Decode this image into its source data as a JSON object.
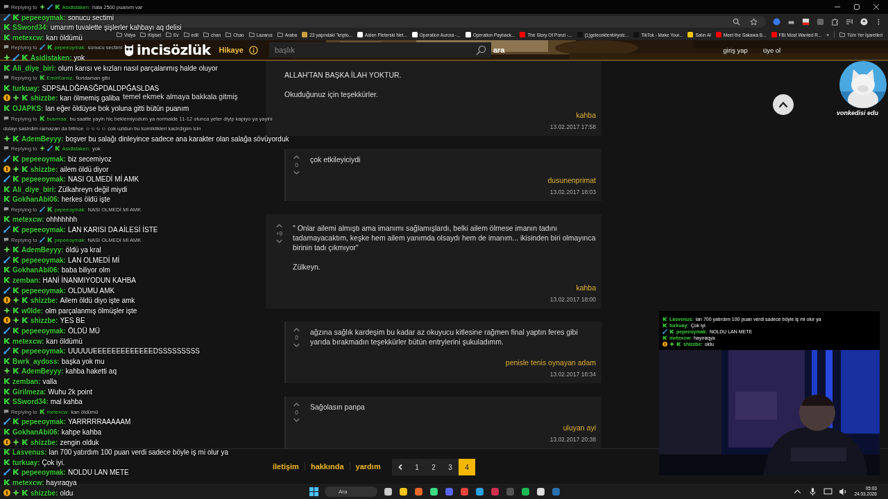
{
  "browser": {
    "bookmarks": [
      {
        "kind": "folder",
        "label": "Vidya"
      },
      {
        "kind": "folder",
        "label": "Kişisel"
      },
      {
        "kind": "folder",
        "label": "Ev"
      },
      {
        "kind": "folder",
        "label": "edit"
      },
      {
        "kind": "folder",
        "label": "chan"
      },
      {
        "kind": "folder",
        "label": "Chao"
      },
      {
        "kind": "folder",
        "label": "Lazarus"
      },
      {
        "kind": "folder",
        "label": "Araba"
      },
      {
        "kind": "link",
        "label": "23 yaşındaki \"kripto...",
        "color": "#c8a040"
      },
      {
        "kind": "link",
        "label": "Aiden Pleterski Net...",
        "color": "#ffffff"
      },
      {
        "kind": "link",
        "label": "Operation Aurora -...",
        "color": "#ffffff"
      },
      {
        "kind": "link",
        "label": "Operation Payback...",
        "color": "#ffffff"
      },
      {
        "kind": "link",
        "label": "The Story Of Ponzi -...",
        "color": "#ff0000"
      },
      {
        "kind": "link",
        "label": "(1)gelecektenbiryolc...",
        "color": "#111111"
      },
      {
        "kind": "link",
        "label": "TikTok - Make Your...",
        "color": "#111111"
      },
      {
        "kind": "link",
        "label": "Satın Al",
        "color": "#f5c518"
      },
      {
        "kind": "link",
        "label": "Meet the Sakawa B...",
        "color": "#ff0000"
      },
      {
        "kind": "link",
        "label": "FBI Most Wanted R...",
        "color": "#ff0000"
      }
    ],
    "more": "»",
    "all_bookmarks": "Tüm Yer İşaretleri"
  },
  "site_header": {
    "logo": "incisözlük",
    "story": "Hikaye",
    "search": {
      "placeholder": "başlık"
    },
    "search_button": "ara",
    "login": "giriş yap",
    "register": "üye ol"
  },
  "sidebar": {
    "topics": [
      "temel ekmek almaya bakkala gitmiş"
    ]
  },
  "entries": [
    {
      "kind": "entry",
      "paragraphs": [
        "ALLAH'TAN BAŞKA İLAH YOKTUR.",
        "Okuduğunuz için teşekkürler."
      ],
      "author": "kahba",
      "date": "13.02.2017 17:58"
    },
    {
      "kind": "reply",
      "votes": "0",
      "paragraphs": [
        "çok etkileyiciydi"
      ],
      "author": "dusunenprimat",
      "date": "13.02.2017 18:03"
    },
    {
      "kind": "entry",
      "votes": "+9",
      "paragraphs": [
        "\" Onlar ailemi almıştı ama imanımı sağlamışlardı, belki ailem ölmese imanın tadını tadamayacaktım, keşke hem ailem yanımda olsaydı hem de imanım... ikisinden biri olmayınca birinin tadı çıkmıyor\"",
        "Zülkeyn."
      ],
      "author": "kahba",
      "date": "13.02.2017 18:00"
    },
    {
      "kind": "reply",
      "votes": "0",
      "paragraphs": [
        "ağzına sağlık kardeşim bu kadar az okuyucu kitlesine rağmen final yaptın feres gibi yarıda bırakmadın teşekkürler bütün entrylerini şukuladımm."
      ],
      "author": "penisle tenis oynayan adam",
      "date": "13.02.2017 18:34"
    },
    {
      "kind": "reply",
      "votes": "0",
      "paragraphs": [
        "Sağolasın panpa"
      ],
      "author": "uluyan ayi",
      "date": "13.02.2017 20:38"
    }
  ],
  "pagination": {
    "pages": [
      {
        "label": "1",
        "selected": false
      },
      {
        "label": "2",
        "selected": false
      },
      {
        "label": "3",
        "selected": false
      },
      {
        "label": "4",
        "selected": true
      }
    ]
  },
  "footer": {
    "links": [
      "iletişim",
      "hakkında",
      "yardım"
    ]
  },
  "profile_overlay": {
    "label": "vonkedisi edu"
  },
  "chat": {
    "lines": [
      {
        "kind": "reply",
        "label": "Replying to",
        "badges": [
          {
            "kind": "diamond"
          },
          {
            "kind": "sword"
          }
        ],
        "user": "Asidistaken:",
        "text": "hala 2500 puanım var"
      },
      {
        "kind": "message",
        "badges": [
          {
            "kind": "sword"
          }
        ],
        "user": "pepeeoymak:",
        "text": "sonucu sectimi"
      },
      {
        "kind": "message",
        "user": "SSword34:",
        "text": "umarım tuvalette şişlerler kahbayı aq delisi"
      },
      {
        "kind": "message",
        "user": "metexcw:",
        "text": "karı öldümü"
      },
      {
        "kind": "reply",
        "label": "Replying to",
        "badges": [
          {
            "kind": "sword"
          }
        ],
        "user": "pepeeoymak:",
        "text": "sonucu sectimi"
      },
      {
        "kind": "message",
        "badges": [
          {
            "kind": "diamond"
          },
          {
            "kind": "sword"
          }
        ],
        "user": "Asidistaken:",
        "text": "yok"
      },
      {
        "kind": "message",
        "user": "Ali_diye_biri:",
        "text": "olum karısı ve kızları nasıl parçalanmış halde oluyor"
      },
      {
        "kind": "reply",
        "label": "Replying to",
        "user": "EmirKorniz:",
        "text": "floridaman gibi"
      },
      {
        "kind": "message",
        "user": "turkuay:",
        "text": "SDPSALDĞPASĞPDALDPĞASLDAS"
      },
      {
        "kind": "message",
        "badges": [
          {
            "kind": "one"
          },
          {
            "kind": "diamond"
          }
        ],
        "user": "shizzbe:",
        "text": "karı ölmemiş galiba"
      },
      {
        "kind": "message",
        "user": "OJAPKS:",
        "text": "lan eğer öldüyse bok yoluna gitti bütün puanım"
      },
      {
        "kind": "reply",
        "label": "Replying to",
        "user": "busrrraa:",
        "text": "bu saatte yayin hic beklemiyodum ya normalde 11-12 olunca yeter diyip kapiyo ya yayini",
        "continuation": "dolayı sasirdim ramazan da bitince ☺☺☺☺ cok uzldun bu komiklikleri kacirdigim icin"
      },
      {
        "kind": "message",
        "badges": [
          {
            "kind": "diamond"
          }
        ],
        "user": "AdemBeyyy:",
        "text": "boşver bu salağı dinleyince sadece ana karakter olan salağa sövüyorduk"
      },
      {
        "kind": "reply",
        "label": "Replying to",
        "badges": [
          {
            "kind": "diamond"
          },
          {
            "kind": "sword"
          }
        ],
        "user": "Asidistaken:",
        "text": "yok"
      },
      {
        "kind": "message",
        "badges": [
          {
            "kind": "sword"
          }
        ],
        "user": "pepeeoymak:",
        "text": "biz secemiyoz"
      },
      {
        "kind": "message",
        "badges": [
          {
            "kind": "one"
          },
          {
            "kind": "diamond"
          }
        ],
        "user": "shizzbe:",
        "text": "ailem öldü diyor"
      },
      {
        "kind": "message",
        "badges": [
          {
            "kind": "sword"
          }
        ],
        "user": "pepeeoymak:",
        "text": "NASI OLMEDİ Mİ AMK"
      },
      {
        "kind": "message",
        "user": "Ali_diye_biri:",
        "text": "Zülkahreyn değil miydi"
      },
      {
        "kind": "message",
        "user": "GokhanAbi06:",
        "text": "herkes öldü işte"
      },
      {
        "kind": "reply",
        "label": "Replying to",
        "badges": [
          {
            "kind": "sword"
          }
        ],
        "user": "pepeeoymak:",
        "text": "NASI OLMEDİ Mİ AMK"
      },
      {
        "kind": "message",
        "user": "metexcw:",
        "text": "ohhhhhhh"
      },
      {
        "kind": "message",
        "badges": [
          {
            "kind": "sword"
          }
        ],
        "user": "pepeeoymak:",
        "text": "LAN KARISI DA AİLESİ İSTE"
      },
      {
        "kind": "reply",
        "label": "Replying to",
        "badges": [
          {
            "kind": "sword"
          }
        ],
        "user": "pepeeoymak:",
        "text": "NASI OLMEDİ Mİ AMK"
      },
      {
        "kind": "message",
        "badges": [
          {
            "kind": "diamond"
          }
        ],
        "user": "AdemBeyyy:",
        "text": "öldü ya kral"
      },
      {
        "kind": "message",
        "badges": [
          {
            "kind": "sword"
          }
        ],
        "user": "pepeeoymak:",
        "text": "LAN OLMEDİ Mİ"
      },
      {
        "kind": "message",
        "user": "GokhanAbi06:",
        "text": "baba biliyor olm"
      },
      {
        "kind": "message",
        "user": "zemban:",
        "text": "HANİ İNANMIYODUN KAHBA"
      },
      {
        "kind": "message",
        "badges": [
          {
            "kind": "sword"
          }
        ],
        "user": "pepeeoymak:",
        "text": "OLDUMU AMK"
      },
      {
        "kind": "message",
        "badges": [
          {
            "kind": "one"
          },
          {
            "kind": "diamond"
          }
        ],
        "user": "shizzbe:",
        "text": "Ailem öldü diyo işte amk"
      },
      {
        "kind": "message",
        "badges": [
          {
            "kind": "diamond"
          }
        ],
        "user": "w0lde:",
        "text": "olm parçalanmış ölmüşler işte"
      },
      {
        "kind": "message",
        "badges": [
          {
            "kind": "one"
          },
          {
            "kind": "diamond"
          }
        ],
        "user": "shizzbe:",
        "text": "YES BE"
      },
      {
        "kind": "message",
        "badges": [
          {
            "kind": "sword"
          }
        ],
        "user": "pepeeoymak:",
        "text": "ÖLDÜ MÜ"
      },
      {
        "kind": "message",
        "user": "metexcw:",
        "text": "karı öldümü"
      },
      {
        "kind": "message",
        "badges": [
          {
            "kind": "sword"
          }
        ],
        "user": "pepeeoymak:",
        "text": "UUUUUEEEEEEEEEEEEEDSSSSSSSSS"
      },
      {
        "kind": "message",
        "user": "Bwrk_aydoss:",
        "text": "başka yok mu"
      },
      {
        "kind": "message",
        "badges": [
          {
            "kind": "diamond"
          }
        ],
        "user": "AdemBeyyy:",
        "text": "kahba haketti aq"
      },
      {
        "kind": "message",
        "user": "zemban:",
        "text": "valla"
      },
      {
        "kind": "message",
        "user": "Girilmeza:",
        "text": "Wuhu 2k point"
      },
      {
        "kind": "message",
        "user": "SSword34:",
        "text": "mal kahba"
      },
      {
        "kind": "reply",
        "label": "Replying to",
        "user": "metexcw:",
        "text": "karı öldümü"
      },
      {
        "kind": "message",
        "badges": [
          {
            "kind": "sword"
          }
        ],
        "user": "pepeeoymak:",
        "text": "YARRRRRAAAAAM"
      },
      {
        "kind": "message",
        "user": "GokhanAbi06:",
        "text": "kahpe kahba"
      },
      {
        "kind": "message",
        "badges": [
          {
            "kind": "one"
          },
          {
            "kind": "diamond"
          }
        ],
        "user": "shizzbe:",
        "text": "zengin olduk"
      },
      {
        "kind": "message",
        "user": "Lasvenus:",
        "text": "lan 700 yatırdım 100 puan verdi sadece böyle iş mi olur ya"
      },
      {
        "kind": "message",
        "user": "turkuay:",
        "text": "Çok iyi."
      },
      {
        "kind": "message",
        "badges": [
          {
            "kind": "sword"
          }
        ],
        "user": "pepeeoymak:",
        "text": "NOLDU LAN METE"
      },
      {
        "kind": "message",
        "user": "metexcw:",
        "text": "hayıraqya"
      },
      {
        "kind": "message",
        "badges": [
          {
            "kind": "one"
          },
          {
            "kind": "diamond"
          }
        ],
        "user": "shizzbe:",
        "text": "oldu"
      }
    ]
  },
  "webcam": {
    "chat_lines": [
      {
        "kind": "message",
        "user": "Lasvenus:",
        "text": "lan 700 yatırdım 100 puan verdi sadece böyle iş mi olur ya"
      },
      {
        "kind": "message",
        "user": "turkuay:",
        "text": "Çok iyi."
      },
      {
        "kind": "message",
        "badges": [
          {
            "kind": "sword"
          }
        ],
        "user": "pepeeoymak:",
        "text": "NOLDU LAN METE"
      },
      {
        "kind": "message",
        "user": "metexcw:",
        "text": "hayıraqya"
      },
      {
        "kind": "message",
        "badges": [
          {
            "kind": "one"
          },
          {
            "kind": "diamond"
          }
        ],
        "user": "shizzbe:",
        "text": "oldu"
      }
    ]
  },
  "taskbar": {
    "search": {
      "placeholder": "Ara"
    },
    "time": "05:03",
    "date": "24.03.2026"
  }
}
